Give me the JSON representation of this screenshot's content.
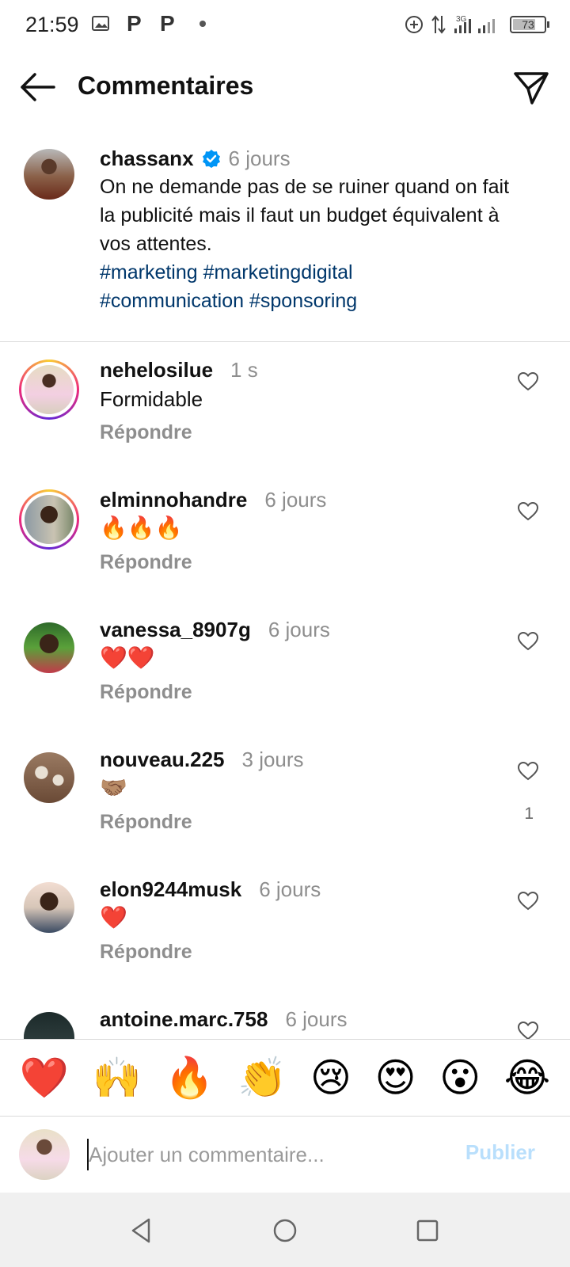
{
  "status_bar": {
    "time": "21:59",
    "notification_p1": "P",
    "notification_p2": "P",
    "network_type": "3G",
    "battery": "73",
    "battery_level_percent": 73,
    "icons": [
      "gallery-icon",
      "dot-icon",
      "data-saver-icon",
      "signal-icon",
      "battery-icon"
    ]
  },
  "header": {
    "title": "Commentaires",
    "back_icon": "arrow-left-icon",
    "share_icon": "paper-plane-icon"
  },
  "caption": {
    "username": "chassanx",
    "verified": true,
    "time": "6 jours",
    "text": "On ne demande pas de se ruiner quand on fait la publicité mais il faut un budget équivalent à vos attentes.",
    "hashtags_line1": "#marketing #marketingdigital",
    "hashtags_line2": "#communication #sponsoring"
  },
  "comments": [
    {
      "username": "nehelosilue",
      "time": "1 s",
      "text": "Formidable",
      "reply": "Répondre",
      "likes": "",
      "story_ring": true
    },
    {
      "username": "elminnohandre",
      "time": "6 jours",
      "text": "🔥🔥🔥",
      "reply": "Répondre",
      "likes": "",
      "story_ring": true
    },
    {
      "username": "vanessa_8907g",
      "time": "6 jours",
      "text": "❤️❤️",
      "reply": "Répondre",
      "likes": "",
      "story_ring": false
    },
    {
      "username": "nouveau.225",
      "time": "3 jours",
      "text": "🤝🏽",
      "reply": "Répondre",
      "likes": "1",
      "story_ring": false
    },
    {
      "username": "elon9244musk",
      "time": "6 jours",
      "text": "❤️",
      "reply": "Répondre",
      "likes": "",
      "story_ring": false
    },
    {
      "username": "antoine.marc.758",
      "time": "6 jours",
      "text": "",
      "reply": "",
      "likes": "",
      "story_ring": false
    }
  ],
  "reactions": [
    "❤️",
    "🙌",
    "🔥",
    "👏",
    "😢",
    "😍",
    "😮",
    "😂"
  ],
  "input": {
    "placeholder": "Ajouter un commentaire...",
    "value": "",
    "publish_label": "Publier"
  },
  "colors": {
    "hashtag": "#00376b",
    "secondary_text": "#8e8e8e",
    "verified_badge": "#0095f6",
    "publish_disabled": "#b9dffc"
  }
}
